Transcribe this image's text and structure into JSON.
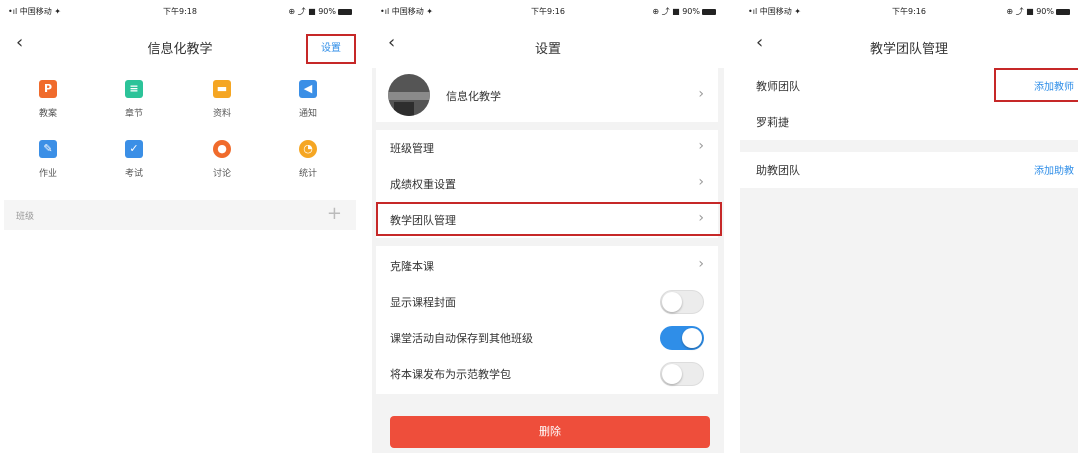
{
  "status": {
    "carrier": "•ıl 中国移动 ✦",
    "time": "下午9:18",
    "battery": "⊕ ⤴ ■ 90%"
  },
  "status2": {
    "time": "下午9:16"
  },
  "status3": {
    "time": "下午9:16"
  },
  "screen1": {
    "title": "信息化教学",
    "settings_label": "设置",
    "grid": [
      {
        "label": "教案",
        "icon": "doc-icon",
        "glyph": "P",
        "color": "#f06b2c"
      },
      {
        "label": "章节",
        "icon": "chapter-icon",
        "glyph": "≡",
        "color": "#2cc399"
      },
      {
        "label": "资料",
        "icon": "folder-icon",
        "glyph": "▬",
        "color": "#f5a623"
      },
      {
        "label": "通知",
        "icon": "speaker-icon",
        "glyph": "◀",
        "color": "#3b8fe6"
      },
      {
        "label": "作业",
        "icon": "homework-icon",
        "glyph": "✎",
        "color": "#3b8fe6"
      },
      {
        "label": "考试",
        "icon": "exam-icon",
        "glyph": "✓",
        "color": "#3b8fe6"
      },
      {
        "label": "讨论",
        "icon": "chat-icon",
        "glyph": "●",
        "color": "#f06b2c"
      },
      {
        "label": "统计",
        "icon": "pie-icon",
        "glyph": "◔",
        "color": "#f5a623"
      }
    ],
    "class_label": "班级",
    "add_symbol": "+"
  },
  "screen2": {
    "title": "设置",
    "course_name": "信息化教学",
    "items": [
      "班级管理",
      "成绩权重设置",
      "教学团队管理"
    ],
    "clone_label": "克隆本课",
    "toggles": [
      {
        "label": "显示课程封面",
        "on": false
      },
      {
        "label": "课堂活动自动保存到其他班级",
        "on": true
      },
      {
        "label": "将本课发布为示范教学包",
        "on": false
      }
    ],
    "delete_label": "删除"
  },
  "screen3": {
    "title": "教学团队管理",
    "teacher_team_label": "教师团队",
    "add_teacher_label": "添加教师",
    "teacher_name": "罗莉捷",
    "assistant_team_label": "助教团队",
    "add_assistant_label": "添加助教"
  },
  "colors": {
    "accent": "#2f8ee8",
    "danger": "#ee4e3b",
    "highlight": "#c62828"
  }
}
